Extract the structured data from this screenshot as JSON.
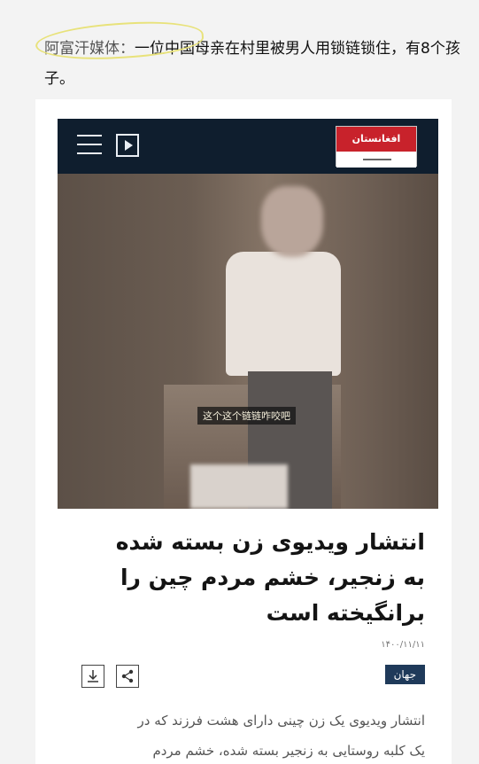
{
  "caption": {
    "source": "阿富汗媒体：",
    "text": "一位中国母亲在村里被男人用锁链锁住，有8个孩子。"
  },
  "article": {
    "logo_text": "افغانستان",
    "video_subtitle": "这个这个链链咋咬吧",
    "headline_lines": [
      "انتشار ویدیوی زن بسته شده",
      "به زنجیر، خشم مردم چین را",
      "برانگیخته است"
    ],
    "date": "۱۴۰۰/۱۱/۱۱",
    "category": "جهان",
    "body_lines": [
      "انتشار ویدیوی یک زن چینی دارای هشت فرزند که در",
      "یک کلبه روستایی به زنجیر بسته شده، خشم مردم"
    ]
  },
  "icons": {
    "menu": "menu-icon",
    "play": "play-icon",
    "download": "download-icon",
    "share": "share-icon"
  },
  "colors": {
    "header_bar": "#0f1e2e",
    "logo_red": "#c8222b",
    "category_badge": "#1f3a5a",
    "source_highlight": "#e8e27a"
  }
}
